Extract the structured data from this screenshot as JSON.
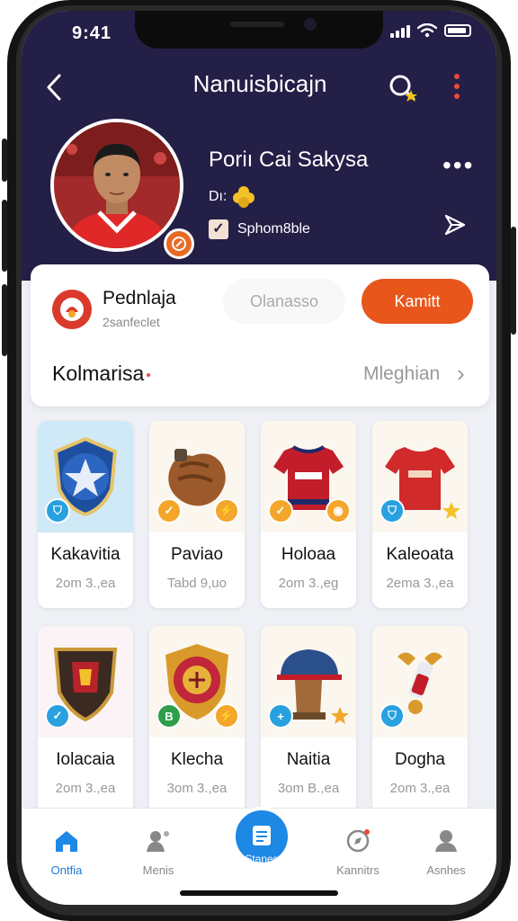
{
  "status": {
    "time": "9:41"
  },
  "nav": {
    "title": "Nanuisbicajn"
  },
  "profile": {
    "name": "Poriı Cai Sakysa",
    "sub_text": "Dı:",
    "check_label": "Sphom8ble",
    "more": "•••"
  },
  "team": {
    "name": "Pednlaja",
    "sub": "2sanfeclet",
    "secondary_button": "Olanasso",
    "primary_button": "Kamitt"
  },
  "section": {
    "title": "Kolmarisa",
    "link": "Mleghian"
  },
  "items": [
    {
      "name": "Kakavitia",
      "meta": "2om 3.,ea",
      "icon": "star-shield-icon",
      "thumb_bg": "#cfe9f7",
      "badge_color": "#29a0e0",
      "badge_icon": "shield-badge-icon",
      "accent_color": "#f28a2e"
    },
    {
      "name": "Paviao",
      "meta": "Tabd 9,uo",
      "icon": "baseball-glove-icon",
      "thumb_bg": "#fbf7ef",
      "badge_color": "#f3a62a",
      "badge_icon": "check-badge-icon",
      "accent_color": "#f3a62a"
    },
    {
      "name": "Holoaa",
      "meta": "2om 3.,eg",
      "icon": "red-jersey-icon",
      "thumb_bg": "#fbf7ef",
      "badge_color": "#f3a62a",
      "badge_icon": "check-badge-icon",
      "accent_color": "#f3a62a"
    },
    {
      "name": "Kaleoata",
      "meta": "2ema 3.,ea",
      "icon": "red-shirt-icon",
      "thumb_bg": "#fbf7ef",
      "badge_color": "#29a0e0",
      "badge_icon": "shield-badge-icon",
      "accent_color": "#f3c12a"
    },
    {
      "name": "Iolacaia",
      "meta": "2om 3.,ea",
      "icon": "dark-crest-icon",
      "thumb_bg": "#fbf3f6",
      "badge_color": "#29a0e0",
      "badge_icon": "check-badge-icon",
      "accent_color": "#29a0e0"
    },
    {
      "name": "Klecha",
      "meta": "3om 3.,ea",
      "icon": "crest-medal-icon",
      "thumb_bg": "#fbf7ef",
      "badge_color": "#2e9e4a",
      "badge_icon": "badge-icon",
      "accent_color": "#f3a62a"
    },
    {
      "name": "Naitia",
      "meta": "3om B.,ea",
      "icon": "cap-trophy-icon",
      "thumb_bg": "#fbf7ef",
      "badge_color": "#29a0e0",
      "badge_icon": "plus-badge-icon",
      "accent_color": "#f3a62a"
    },
    {
      "name": "Dogha",
      "meta": "2om 3.,ea",
      "icon": "torch-icon",
      "thumb_bg": "#fbf7ef",
      "badge_color": "#29a0e0",
      "badge_icon": "shield-badge-icon",
      "accent_color": "#29a0e0"
    }
  ],
  "tabs": [
    {
      "label": "Ontfia",
      "icon": "home-icon",
      "active": true
    },
    {
      "label": "Menis",
      "icon": "people-icon",
      "active": false
    },
    {
      "label": "Stanes",
      "icon": "clipboard-icon",
      "active": false
    },
    {
      "label": "Kannitrs",
      "icon": "compass-icon",
      "active": false
    },
    {
      "label": "Asnhes",
      "icon": "user-icon",
      "active": false
    }
  ],
  "colors": {
    "header_bg": "#231f47",
    "primary": "#e8561c",
    "accent_blue": "#1e88e5",
    "danger": "#e94b3c"
  }
}
